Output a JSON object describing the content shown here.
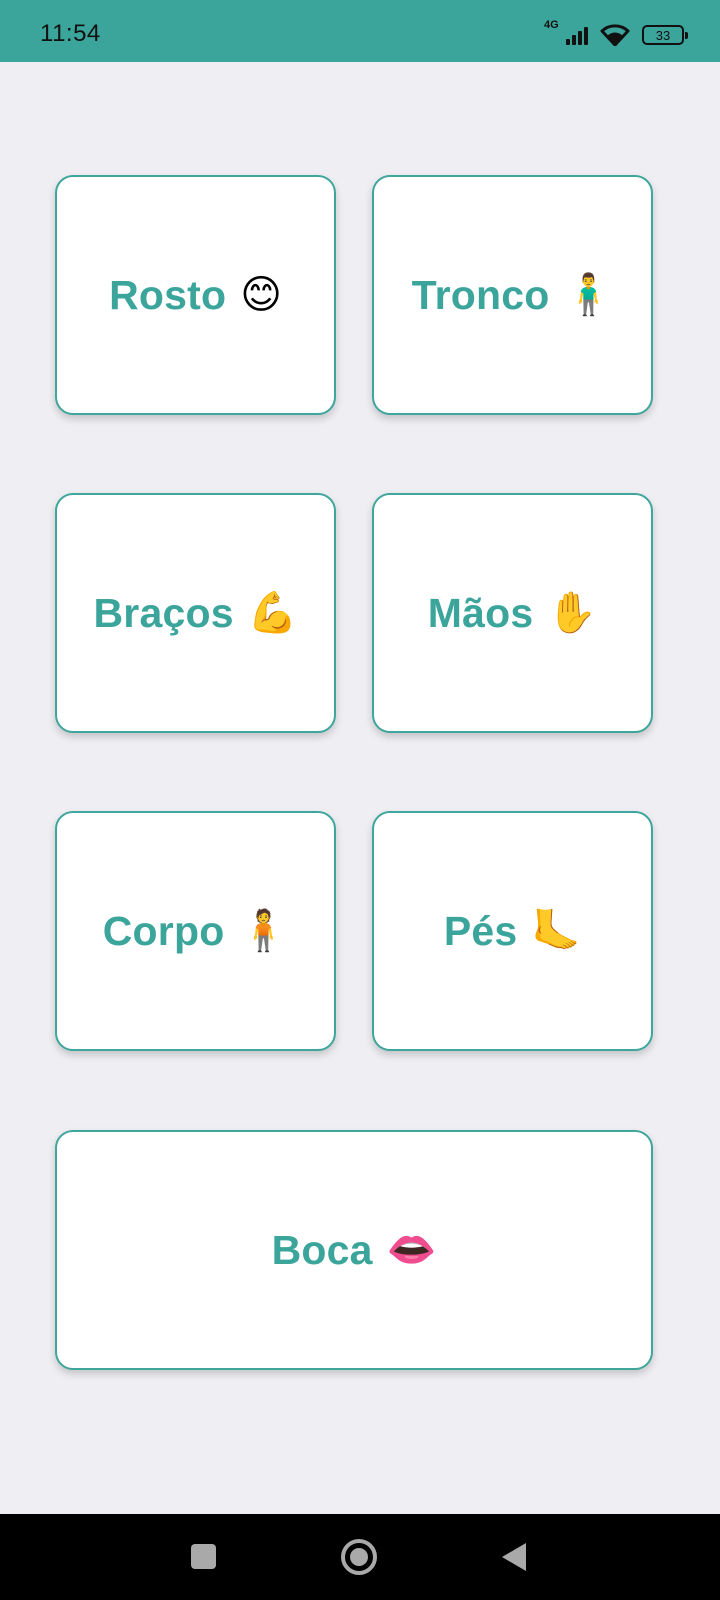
{
  "status_bar": {
    "time": "11:54",
    "network": "4G",
    "battery": "33",
    "background": "#3ba59c"
  },
  "cards": [
    {
      "label": "Rosto",
      "emoji": "😊",
      "icon": "smiling-face-icon"
    },
    {
      "label": "Tronco",
      "emoji": "🧍‍♂️",
      "icon": "standing-man-icon"
    },
    {
      "label": "Braços",
      "emoji": "💪",
      "icon": "flexed-biceps-icon"
    },
    {
      "label": "Mãos",
      "emoji": "✋",
      "icon": "raised-hand-icon"
    },
    {
      "label": "Corpo",
      "emoji": "🧍",
      "icon": "standing-person-icon"
    },
    {
      "label": "Pés",
      "emoji": "🦶",
      "icon": "foot-icon"
    },
    {
      "label": "Boca",
      "emoji": "👄",
      "icon": "mouth-icon"
    }
  ],
  "theme": {
    "accent": "#3ba59c",
    "card_background": "#ffffff",
    "page_background": "#efeff3"
  },
  "nav_bar": {
    "recents_icon": "square-icon",
    "home_icon": "circle-icon",
    "back_icon": "triangle-back-icon"
  }
}
